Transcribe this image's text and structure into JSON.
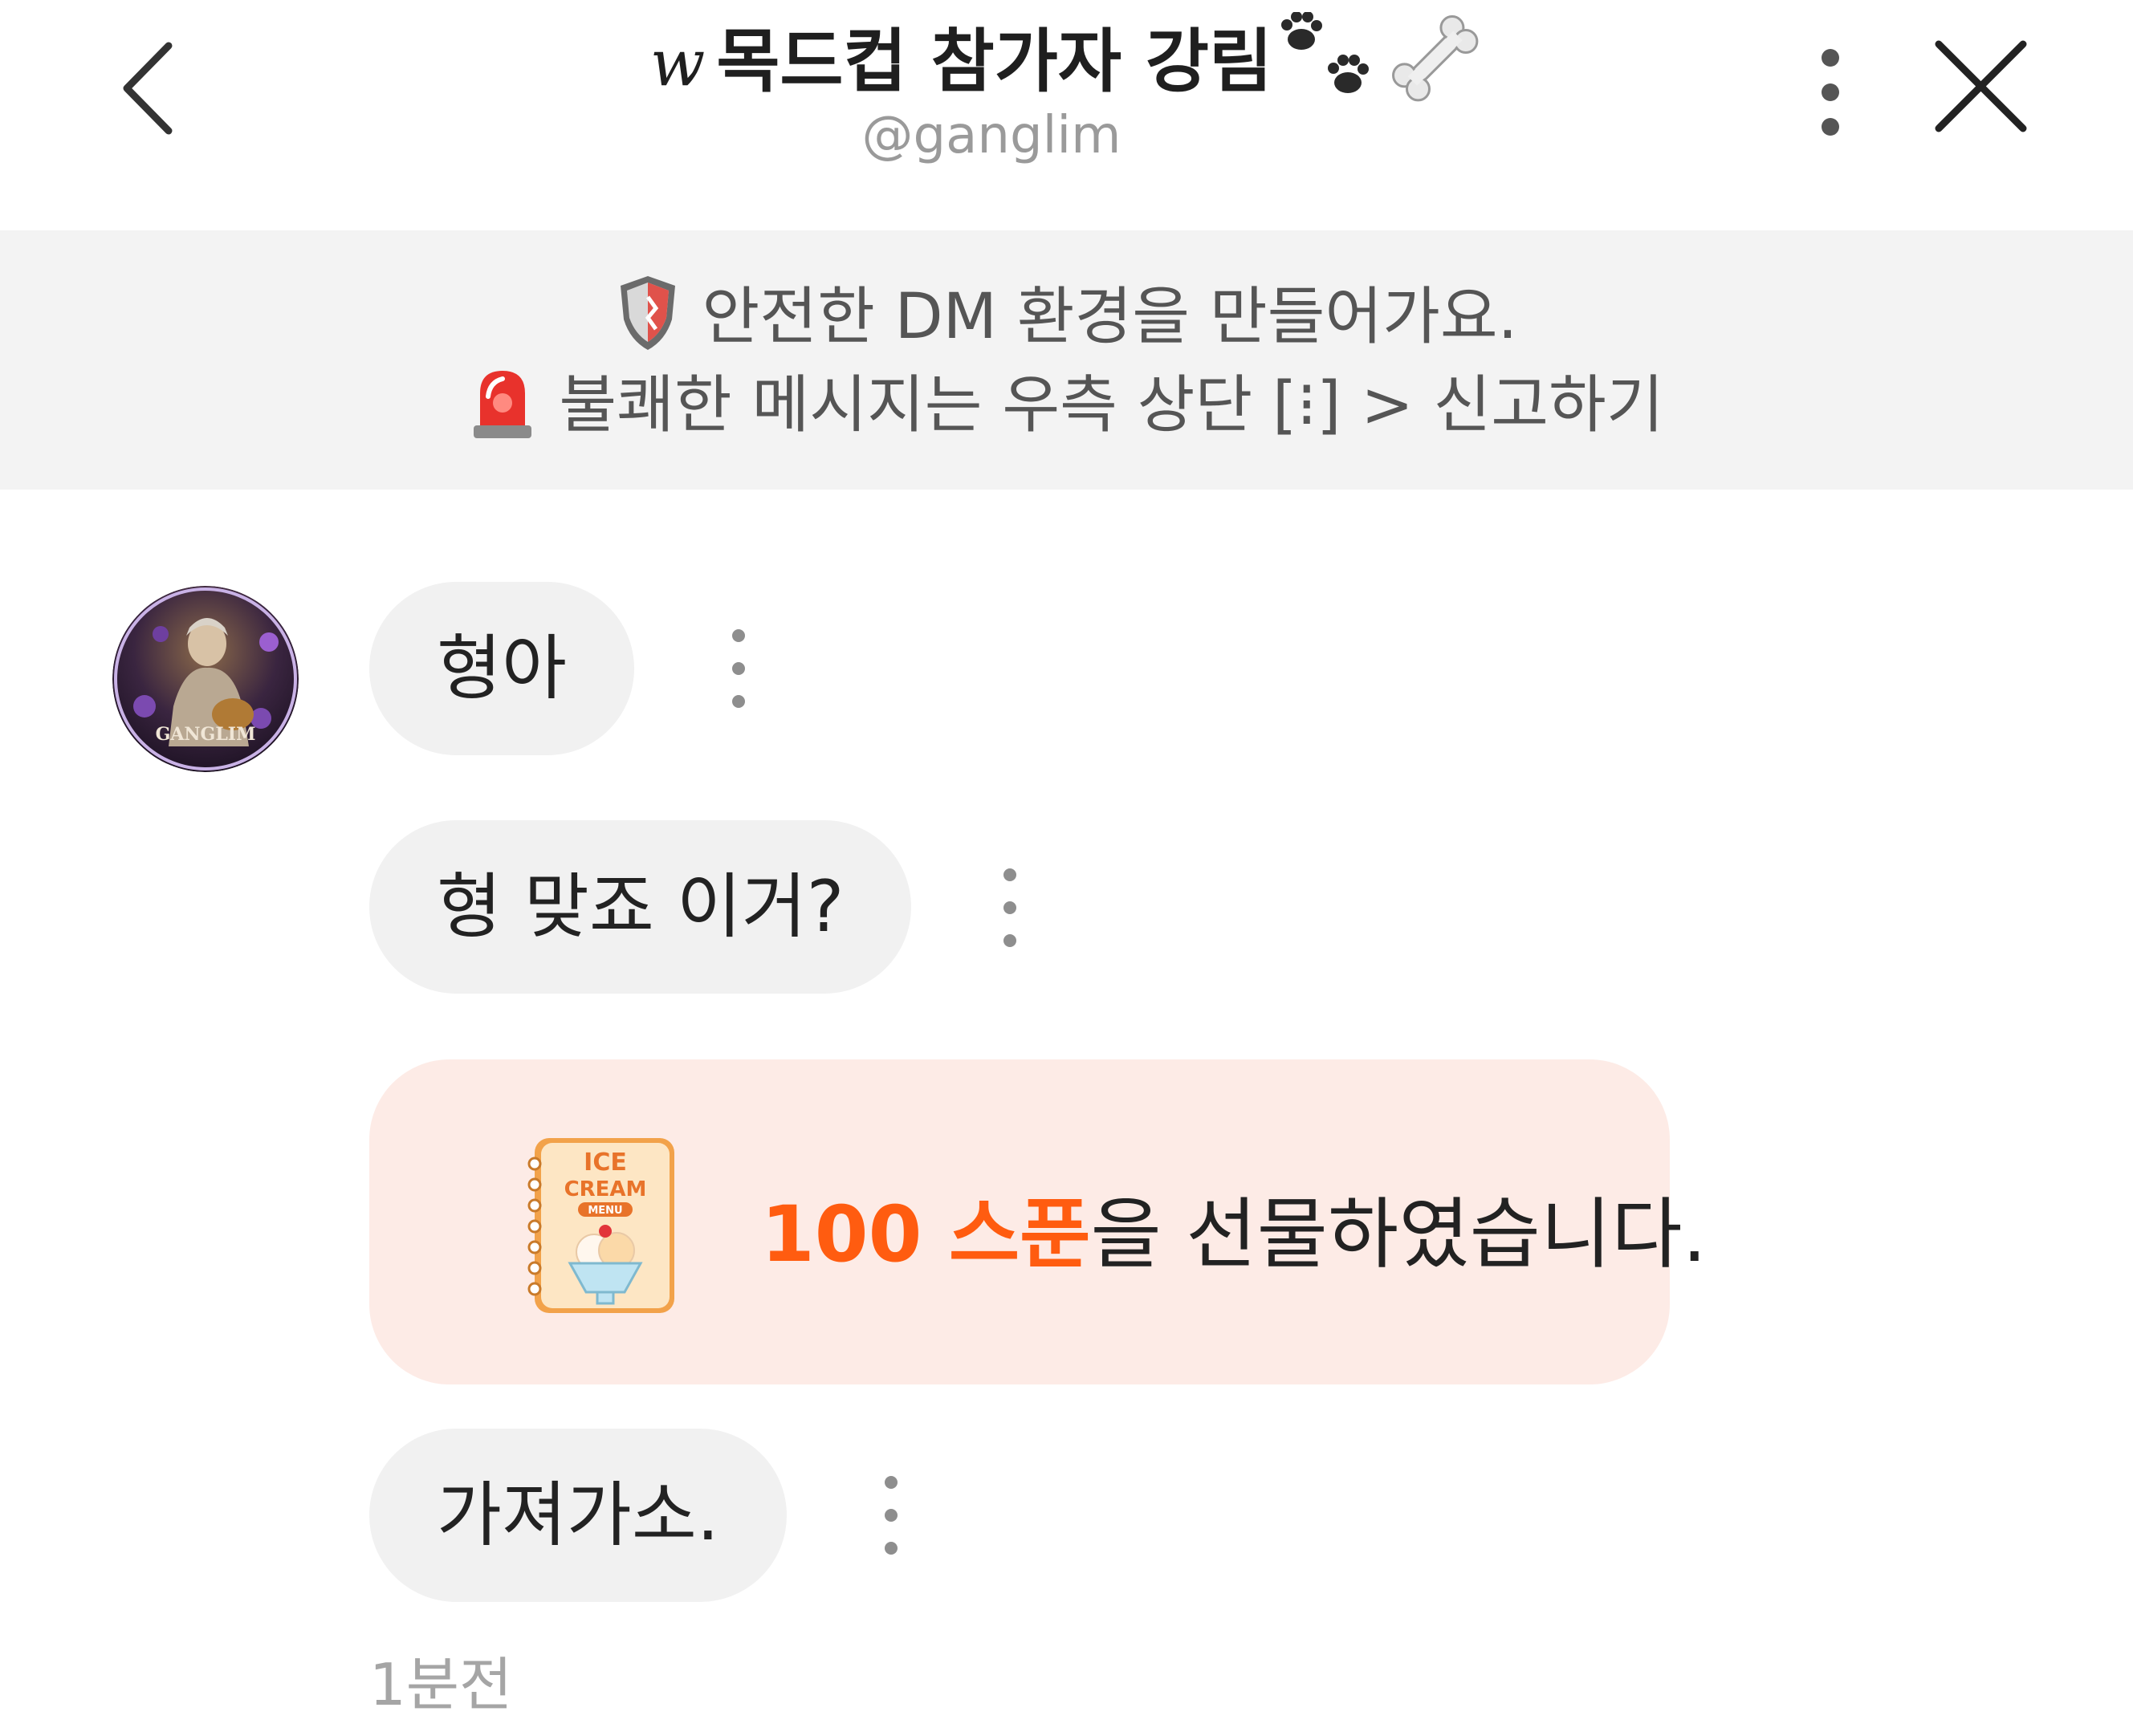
{
  "header": {
    "title_prefix": "w",
    "title": "목드컵 참가자 강림",
    "handle": "@ganglim",
    "icons": {
      "back": "chevron-left-icon",
      "title_decor": [
        "paw-prints-icon",
        "bone-icon"
      ],
      "more": "vertical-ellipsis-icon",
      "close": "close-icon"
    }
  },
  "notice": {
    "line1": "안전한 DM 환경을 만들어가요.",
    "line2": "불쾌한 메시지는 우측 상단 [⁝] > 신고하기",
    "icons": [
      "shield-icon",
      "siren-icon"
    ]
  },
  "chat": {
    "avatar": {
      "text": "GANGLIM"
    },
    "messages": [
      {
        "text": "형아"
      },
      {
        "text": "형 맞죠 이거?"
      },
      {
        "text": "가져가소."
      }
    ],
    "gift": {
      "amount": "100 스푼",
      "suffix": "을 선물하였습니다.",
      "image_label_1": "ICE",
      "image_label_2": "CREAM",
      "image_label_3": "MENU"
    },
    "timestamp": "1분전"
  },
  "colors": {
    "accent": "#ff5c10",
    "bubble": "#f1f1f1",
    "gift_bg": "#fdebe6",
    "notice_bg": "#f3f3f3"
  }
}
